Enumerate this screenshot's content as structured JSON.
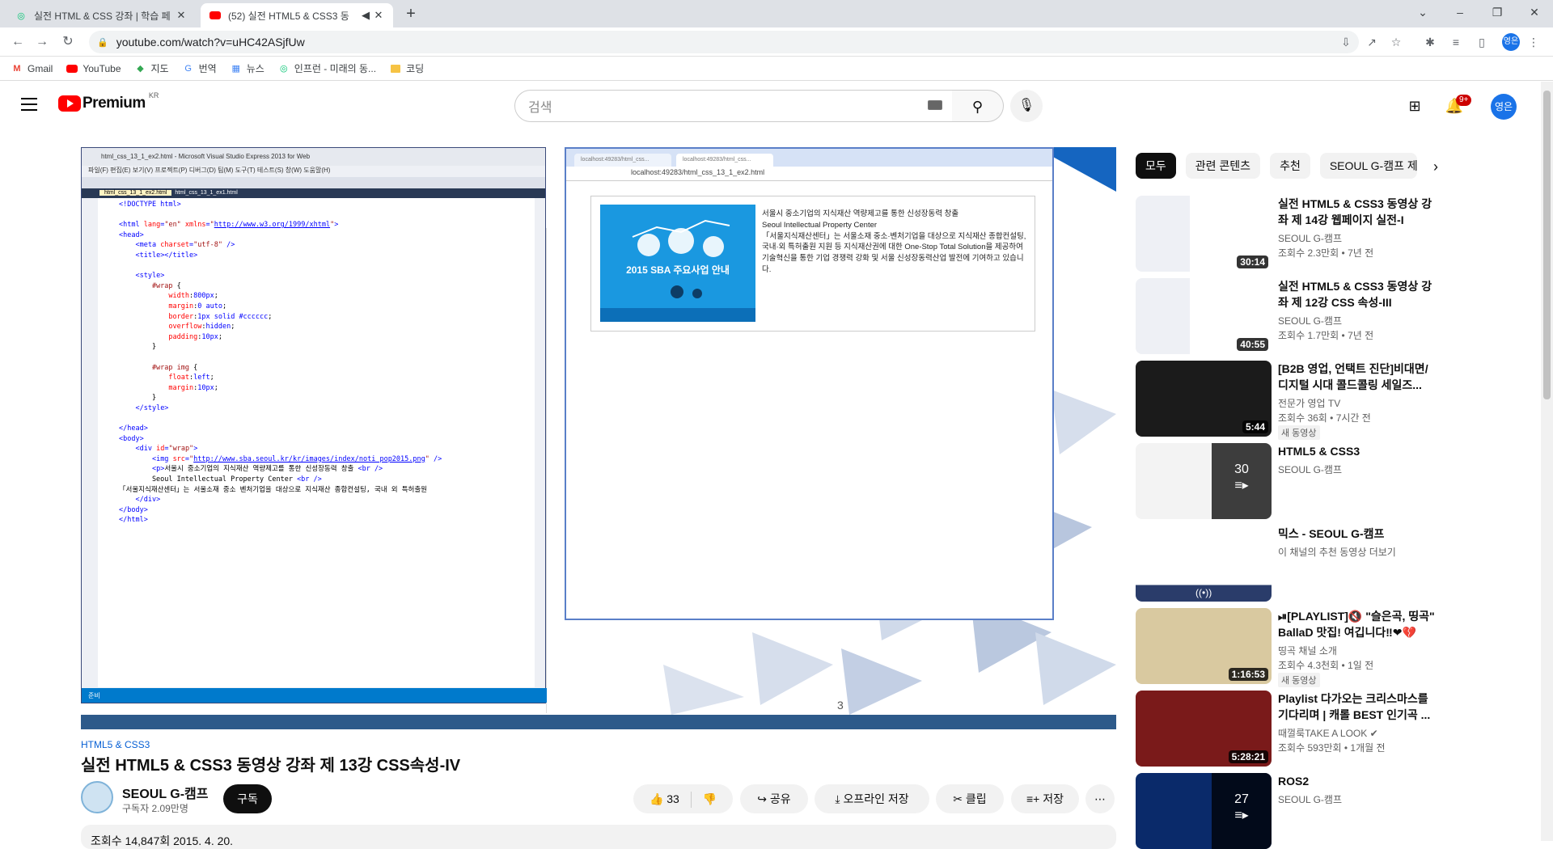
{
  "browser": {
    "tabs": [
      {
        "title": "실전 HTML & CSS 강좌 | 학습 페",
        "active": false
      },
      {
        "title": "(52) 실전 HTML5 & CSS3 동",
        "active": true
      }
    ],
    "url": "youtube.com/watch?v=uHC42ASjfUw",
    "profile_initial": "영은",
    "bookmarks": [
      "Gmail",
      "YouTube",
      "지도",
      "번역",
      "뉴스",
      "인프런 - 미래의 동...",
      "코딩"
    ]
  },
  "header": {
    "logo": "Premium",
    "logo_region": "KR",
    "search_placeholder": "검색",
    "notification_count": "9+",
    "avatar_initial": "영은"
  },
  "video": {
    "category": "HTML5 & CSS3",
    "title": "실전 HTML5 & CSS3 동영상 강좌 제 13강 CSS속성-IV",
    "channel": "SEOUL G-캠프",
    "subscribers": "구독자 2.09만명",
    "subscribe_label": "구독",
    "like_count": "33",
    "share_label": "공유",
    "offline_label": "오프라인 저장",
    "clip_label": "클립",
    "save_label": "저장",
    "description_preview": "조회수 14,847회 2015. 4. 20.",
    "slide_number": "3"
  },
  "screen": {
    "vs_title": "html_css_13_1_ex2.html - Microsoft Visual Studio Express 2013 for Web",
    "vs_menu": "파일(F)  편집(E)  보기(V)  프로젝트(P)  디버그(D)  팀(M)  도구(T)  테스트(S)  창(W)  도움말(H)",
    "vs_tab1": "html_css_13_1_ex2.html",
    "vs_tab2": "html_css_13_1_ex1.html",
    "vs_status": "준비",
    "browser_url": "localhost:49283/html_css_13_1_ex2.html",
    "browser_tab1": "localhost:49283/html_css...",
    "browser_tab2": "localhost:49283/html_css...",
    "banner_text": "2015 SBA 주요사업 안내",
    "page_heading": "서울시 중소기업의 지식재산 역량제고를 통한 신성장동력 창출",
    "page_sub": "Seoul Intellectual Property Center",
    "page_body": "「서울지식재산센터」는 서울소재 중소·벤처기업을 대상으로 지식재산 종합컨설팅, 국내·외 특허출원 지원 등 지식재산권에 대한 One-Stop Total Solution을 제공하여 기술혁신을 통한 기업 경쟁력 강화 및 서울 신성장동력산업 발전에 기여하고 있습니다."
  },
  "sidebar": {
    "chips": [
      "모두",
      "관련 콘텐츠",
      "추천",
      "SEOUL G-캠프 제"
    ],
    "items": [
      {
        "title": "실전 HTML5 & CSS3 동영상 강좌 제 14강 웹페이지 실전-I",
        "channel": "SEOUL G-캠프",
        "meta": "조회수 2.3만회 • 7년 전",
        "duration": "30:14",
        "tag": ""
      },
      {
        "title": "실전 HTML5 & CSS3 동영상 강좌 제 12강 CSS 속성-III",
        "channel": "SEOUL G-캠프",
        "meta": "조회수 1.7만회 • 7년 전",
        "duration": "40:55",
        "tag": ""
      },
      {
        "title": "[B2B 영업, 언택트 진단]비대면/디지털 시대 콜드콜링 세일즈...",
        "channel": "전문가 영업 TV",
        "meta": "조회수 36회 • 7시간 전",
        "duration": "5:44",
        "tag": "새 동영상"
      },
      {
        "title": "HTML5 & CSS3",
        "channel": "SEOUL G-캠프",
        "meta": "",
        "duration": "",
        "tag": "",
        "playlist_count": "30"
      },
      {
        "title": "믹스 - SEOUL G-캠프",
        "channel": "이 채널의 추천 동영상 더보기",
        "meta": "",
        "duration": "",
        "tag": ""
      },
      {
        "title": "⏯[PLAYLIST]🔇 \"슬은곡, 띵곡\" BallaD 맛집! 여깁니다‼❤💔",
        "channel": "띵곡 채널 소개",
        "meta": "조회수 4.3천회 • 1일 전",
        "duration": "1:16:53",
        "tag": "새 동영상"
      },
      {
        "title": "Playlist 다가오는 크리스마스를 기다리며 | 캐롤 BEST 인기곡 ...",
        "channel": "때껄룩TAKE A LOOK ✔",
        "meta": "조회수 593만회 • 1개월 전",
        "duration": "5:28:21",
        "tag": ""
      },
      {
        "title": "ROS2",
        "channel": "SEOUL G-캠프",
        "meta": "",
        "duration": "",
        "tag": "",
        "playlist_count": "27"
      }
    ]
  },
  "colors": {
    "brand_red": "#ff0000",
    "link_blue": "#065fd4"
  }
}
